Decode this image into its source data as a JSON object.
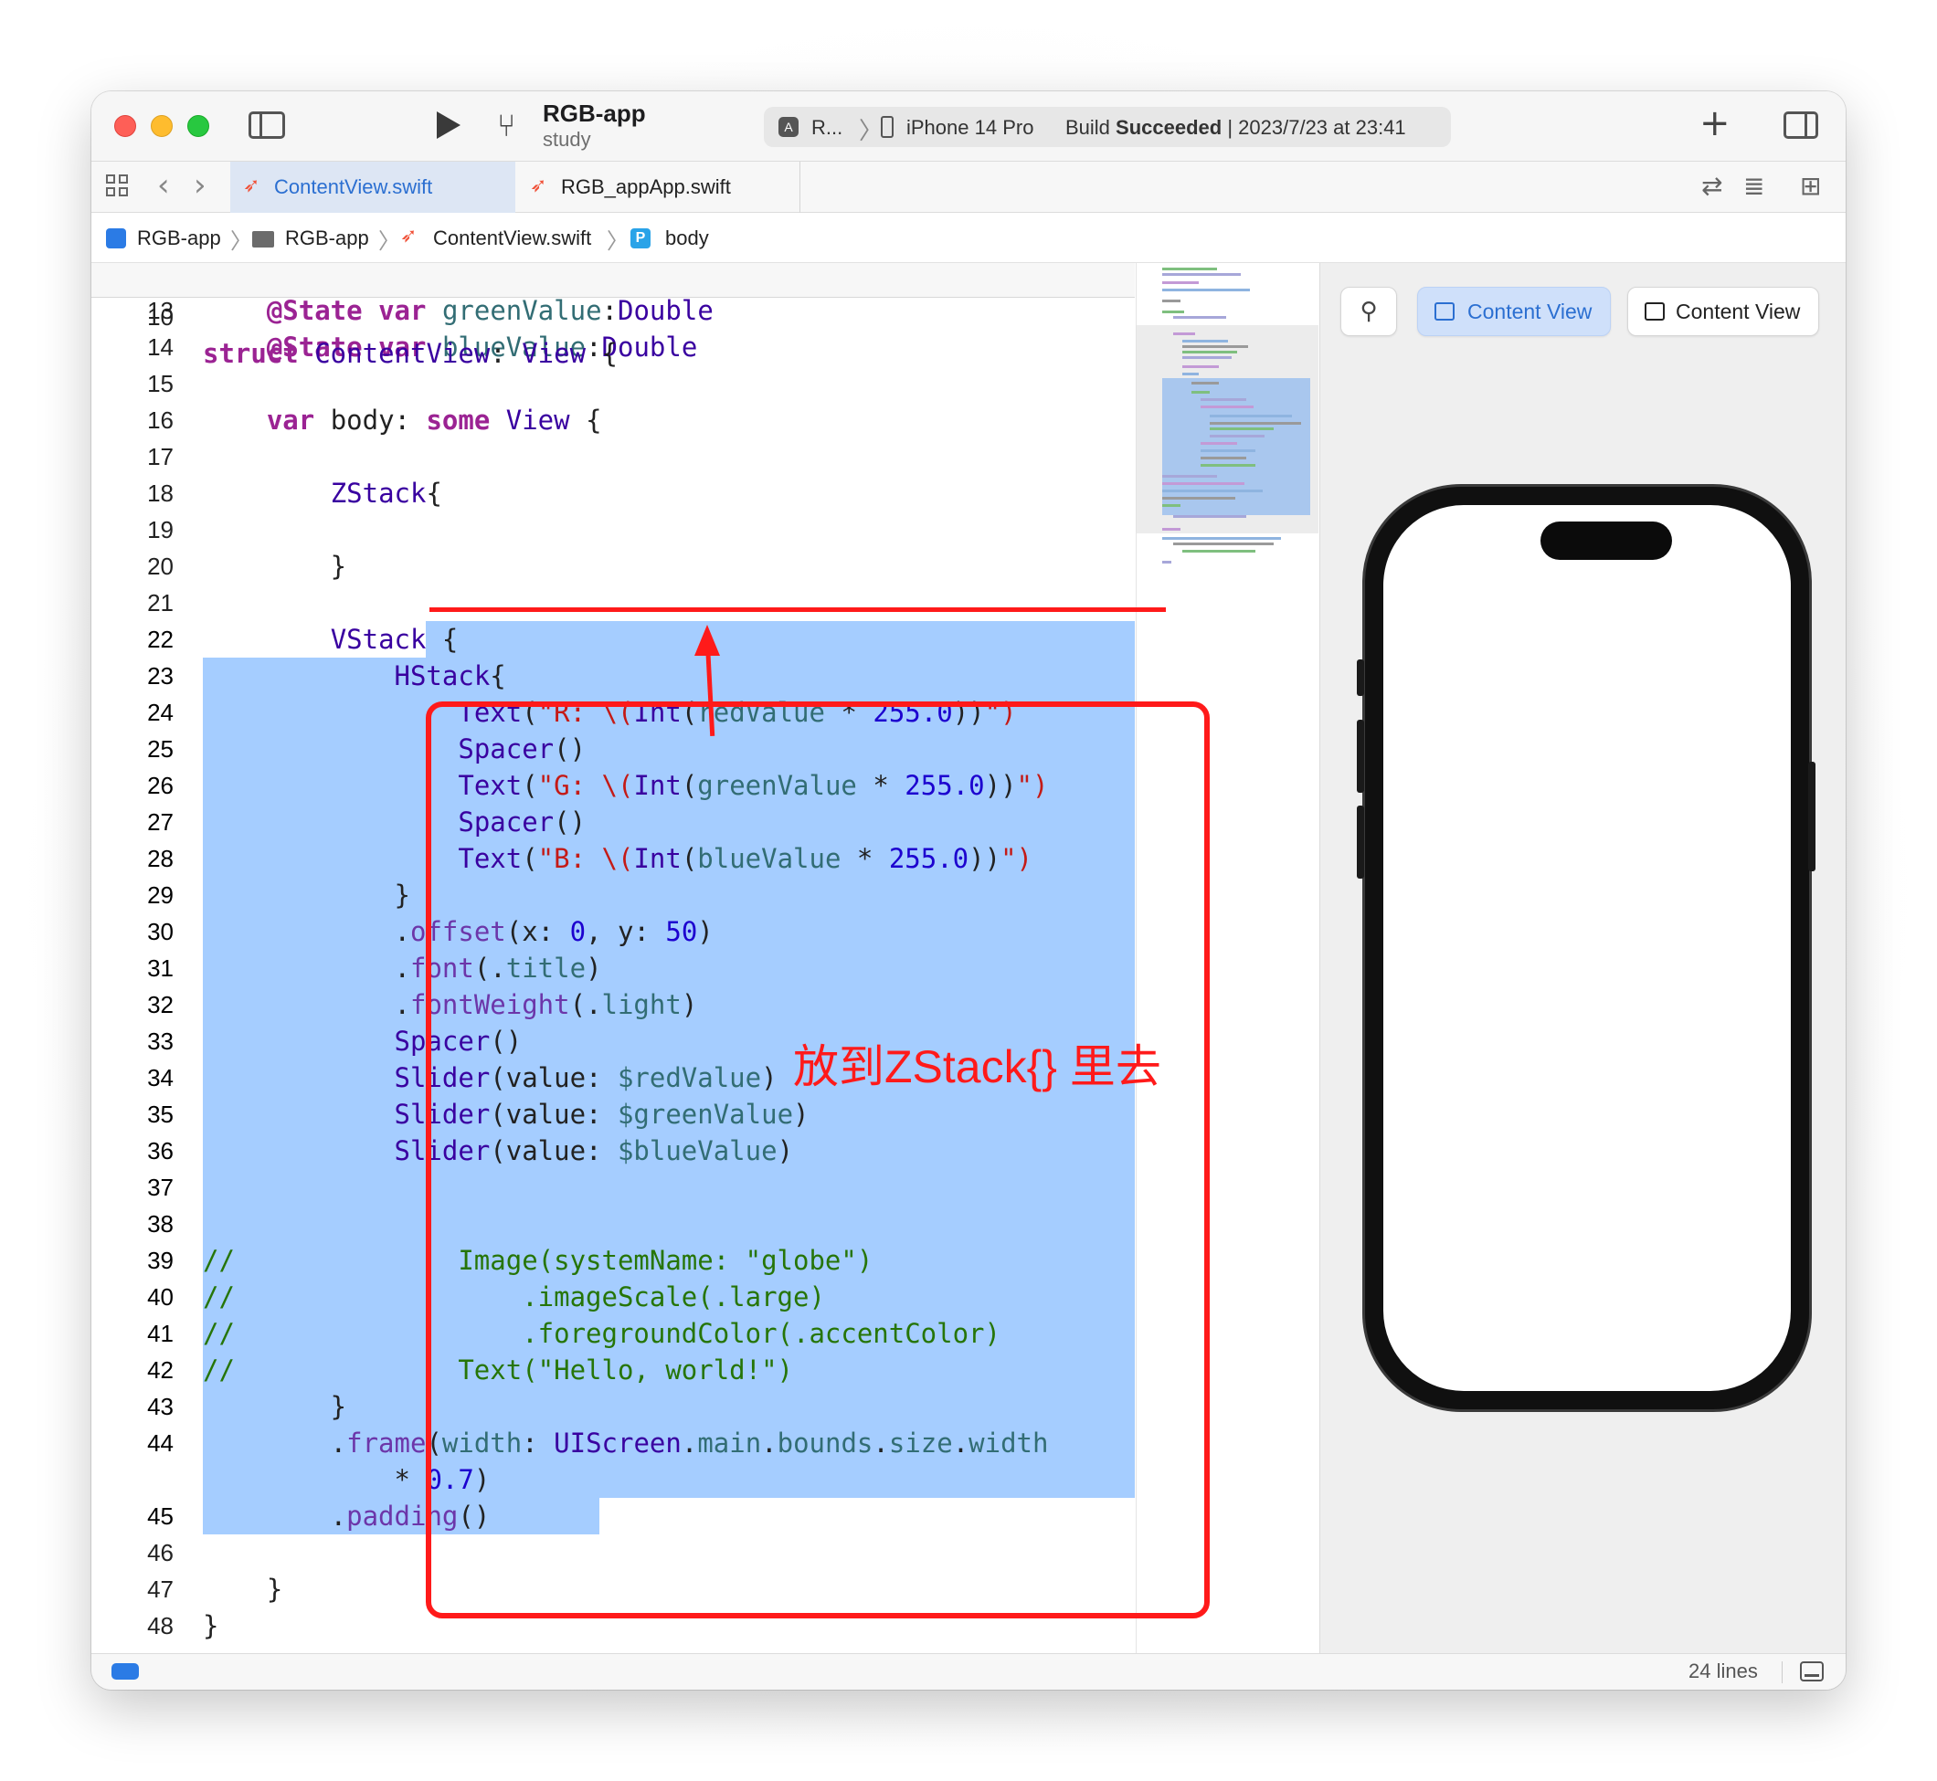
{
  "toolbar": {
    "project_name": "RGB-app",
    "project_subtitle": "study",
    "scheme_label": "R...",
    "device_label": "iPhone 14 Pro",
    "build_status_prefix": "Build",
    "build_status_word": "Succeeded",
    "build_status_time": "| 2023/7/23 at 23:41",
    "icons": [
      "sidebar-toggle-icon",
      "run-icon",
      "branch-icon",
      "plus-icon",
      "inspector-toggle-icon"
    ]
  },
  "tabs": [
    {
      "label": "ContentView.swift",
      "active": true
    },
    {
      "label": "RGB_appApp.swift",
      "active": false
    }
  ],
  "breadcrumb": {
    "items": [
      "RGB-app",
      "RGB-app",
      "ContentView.swift",
      "body"
    ],
    "prop_badge": "P"
  },
  "editor": {
    "sticky_line_number": "10",
    "sticky_header": [
      "struct",
      " ContentView",
      ": ",
      "View",
      " {"
    ],
    "lines": [
      {
        "n": "13",
        "text": "    @State var greenValue:Double"
      },
      {
        "n": "14",
        "text": "    @State var blueValue:Double"
      },
      {
        "n": "15",
        "text": ""
      },
      {
        "n": "16",
        "text": "    var body: some View {"
      },
      {
        "n": "17",
        "text": ""
      },
      {
        "n": "18",
        "text": "        ZStack{"
      },
      {
        "n": "19",
        "text": ""
      },
      {
        "n": "20",
        "text": "        }"
      },
      {
        "n": "21",
        "text": ""
      },
      {
        "n": "22",
        "text": "        VStack {"
      },
      {
        "n": "23",
        "text": "            HStack{"
      },
      {
        "n": "24",
        "text": "                Text(\"R: \\(Int(redValue * 255.0))\")"
      },
      {
        "n": "25",
        "text": "                Spacer()"
      },
      {
        "n": "26",
        "text": "                Text(\"G: \\(Int(greenValue * 255.0))\")"
      },
      {
        "n": "27",
        "text": "                Spacer()"
      },
      {
        "n": "28",
        "text": "                Text(\"B: \\(Int(blueValue * 255.0))\")"
      },
      {
        "n": "29",
        "text": "            }"
      },
      {
        "n": "30",
        "text": "            .offset(x: 0, y: 50)"
      },
      {
        "n": "31",
        "text": "            .font(.title)"
      },
      {
        "n": "32",
        "text": "            .fontWeight(.light)"
      },
      {
        "n": "33",
        "text": "            Spacer()"
      },
      {
        "n": "34",
        "text": "            Slider(value: $redValue)"
      },
      {
        "n": "35",
        "text": "            Slider(value: $greenValue)"
      },
      {
        "n": "36",
        "text": "            Slider(value: $blueValue)"
      },
      {
        "n": "37",
        "text": ""
      },
      {
        "n": "38",
        "text": ""
      },
      {
        "n": "39",
        "text": "//              Image(systemName: \"globe\")"
      },
      {
        "n": "40",
        "text": "//                  .imageScale(.large)"
      },
      {
        "n": "41",
        "text": "//                  .foregroundColor(.accentColor)"
      },
      {
        "n": "42",
        "text": "//              Text(\"Hello, world!\")"
      },
      {
        "n": "43",
        "text": "        }"
      },
      {
        "n": "44",
        "text": "        .frame(width: UIScreen.main.bounds.size.width"
      },
      {
        "n": "",
        "text": "            * 0.7)"
      },
      {
        "n": "45",
        "text": "        .padding()"
      },
      {
        "n": "46",
        "text": ""
      },
      {
        "n": "47",
        "text": "    }"
      },
      {
        "n": "48",
        "text": "}"
      }
    ],
    "selection_color": "#a5cdff"
  },
  "annotation": {
    "note": "放到ZStack{} 里去",
    "color": "#ff1a1a"
  },
  "canvas": {
    "pin_icon": "pin-icon",
    "preview_buttons": [
      {
        "label": "Content View",
        "active": true
      },
      {
        "label": "Content View",
        "active": false
      }
    ],
    "bottom_icons": [
      "live-preview-icon",
      "selectable-icon",
      "variants-icon",
      "device-settings-icon",
      "device-icon",
      "zoom-out-icon",
      "zoom-actual-icon",
      "zoom-in-icon"
    ]
  },
  "statusbar": {
    "lines_label": "24 lines"
  }
}
